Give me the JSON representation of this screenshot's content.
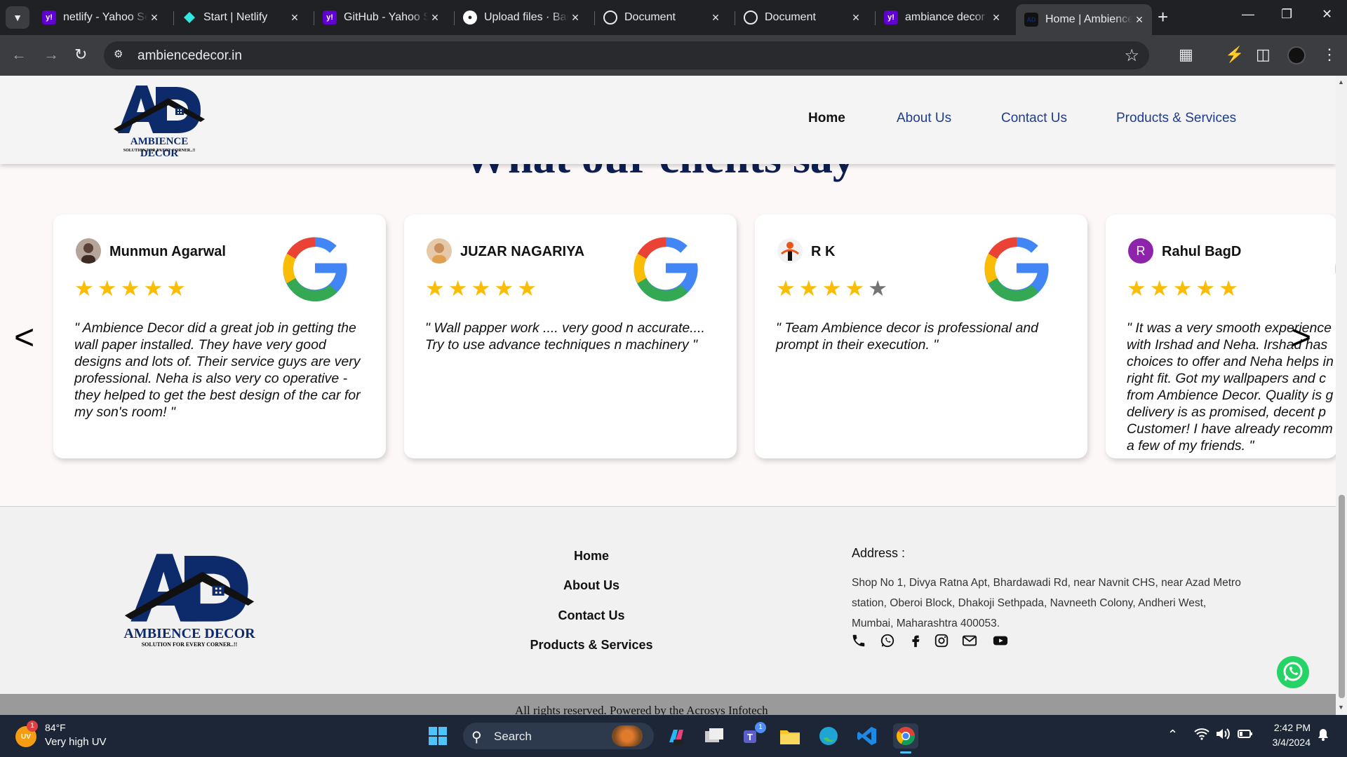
{
  "browser": {
    "tabs": [
      {
        "title": "netlify - Yahoo Search Results",
        "favicon": "yahoo-icon",
        "color": "#6001d2"
      },
      {
        "title": "Start | Netlify",
        "favicon": "netlify-icon",
        "color": "#32e6e2"
      },
      {
        "title": "GitHub - Yahoo Search Results",
        "favicon": "yahoo-icon",
        "color": "#6001d2"
      },
      {
        "title": "Upload files · Backend",
        "favicon": "github-icon",
        "color": "#ffffff"
      },
      {
        "title": "Document",
        "favicon": "globe-icon",
        "color": "#e8eaed"
      },
      {
        "title": "Document",
        "favicon": "globe-icon",
        "color": "#e8eaed"
      },
      {
        "title": "ambiance decor - Yahoo",
        "favicon": "yahoo-icon",
        "color": "#6001d2"
      },
      {
        "title": "Home | Ambience Decor",
        "favicon": "ad-logo-icon",
        "color": "#0d2a6b"
      }
    ],
    "url": "ambiencedecor.in"
  },
  "site": {
    "logo_name": "AMBIENCE DECOR",
    "logo_tagline": "SOLUTION FOR EVERY CORNER..!!",
    "logo_initials": "AD",
    "brand_color": "#0d2a6b",
    "nav": [
      "Home",
      "About Us",
      "Contact Us",
      "Products & Services"
    ],
    "section_title": "What our clients say",
    "prev": "<",
    "next": ">"
  },
  "testimonials": [
    {
      "name": "Munmun Agarwal",
      "rating": 5,
      "quote": "\" Ambience Decor did a great job in getting the wall paper installed. They have very good designs and lots of. Their service guys are very professional. Neha is also very co operative - they helped to get the best design of the car for my son's room! \""
    },
    {
      "name": "JUZAR NAGARIYA",
      "rating": 5,
      "quote": "\" Wall papper work .... very good n accurate.... Try to use advance techniques n machinery \""
    },
    {
      "name": "R K",
      "rating": 4,
      "quote": "\" Team Ambience decor is professional and prompt in their execution. \""
    },
    {
      "name": "Rahul BagD",
      "rating": 5,
      "avatar_letter": "R",
      "quote": "\" It was a very smooth experience with Irshad and Neha. Irshad has choices to offer and Neha helps in right fit. Got my wallpapers and c from Ambience Decor. Quality is g delivery is as promised, decent p Customer! I have already recomm to a few of my friends. \""
    }
  ],
  "footer": {
    "links": [
      "Home",
      "About Us",
      "Contact Us",
      "Products & Services"
    ],
    "address_heading": "Address :",
    "address": "Shop No 1, Divya Ratna Apt, Bhardawadi Rd, near Navnit CHS, near Azad Metro station, Oberoi Block, Dhakoji Sethpada, Navneeth Colony, Andheri West, Mumbai, Maharashtra 400053.",
    "social": [
      "phone-icon",
      "whatsapp-icon",
      "facebook-icon",
      "instagram-icon",
      "mail-icon",
      "youtube-icon"
    ],
    "copyright": "All rights reserved. Powered by the Acrosys Infotech"
  },
  "taskbar": {
    "weather_temp": "84°F",
    "weather_desc": "Very high UV",
    "weather_badge": "1",
    "weather_icon_label": "UV",
    "search_label": "Search",
    "teams_badge": "1",
    "time": "2:42 PM",
    "date": "3/4/2024"
  }
}
